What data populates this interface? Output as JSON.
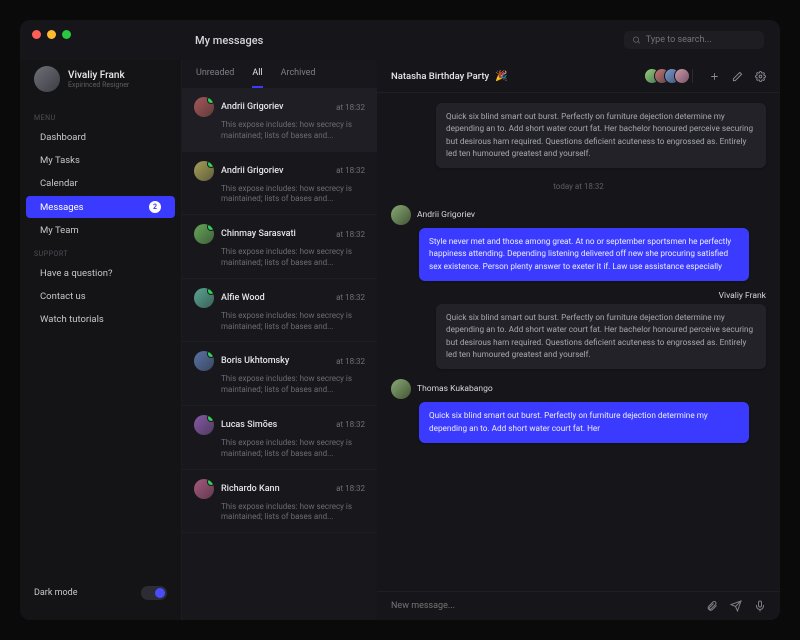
{
  "header": {
    "page_title": "My messages",
    "search_placeholder": "Type to search..."
  },
  "user": {
    "name": "Vivaliy Frank",
    "role": "Expirinced Resigner"
  },
  "menu": {
    "label_main": "MENU",
    "label_support": "SUPPORT",
    "items": [
      {
        "label": "Dashboard"
      },
      {
        "label": "My Tasks"
      },
      {
        "label": "Calendar"
      },
      {
        "label": "Messages",
        "badge": "2"
      },
      {
        "label": "My Team"
      }
    ],
    "support": [
      {
        "label": "Have a question?"
      },
      {
        "label": "Contact us"
      },
      {
        "label": "Watch tutorials"
      }
    ],
    "darkmode_label": "Dark mode"
  },
  "tabs": {
    "unreaded": "Unreaded",
    "all": "All",
    "archived": "Archived"
  },
  "conversations": [
    {
      "name": "Andrii Grigoriev",
      "time": "at 18:32",
      "preview": "This expose includes: how secrecy is maintained; lists of bases and..."
    },
    {
      "name": "Andrii Grigoriev",
      "time": "at 18:32",
      "preview": "This expose includes: how secrecy is maintained; lists of bases and..."
    },
    {
      "name": "Chinmay Sarasvati",
      "time": "at 18:32",
      "preview": "This expose includes: how secrecy is maintained; lists of bases and..."
    },
    {
      "name": "Alfie Wood",
      "time": "at 18:32",
      "preview": "This expose includes: how secrecy is maintained; lists of bases and..."
    },
    {
      "name": "Boris Ukhtomsky",
      "time": "at 18:32",
      "preview": "This expose includes: how secrecy is maintained; lists of bases and..."
    },
    {
      "name": "Lucas Simões",
      "time": "at 18:32",
      "preview": "This expose includes: how secrecy is maintained; lists of bases and..."
    },
    {
      "name": "Richardo Kann",
      "time": "at 18:32",
      "preview": "This expose includes: how secrecy is maintained; lists of bases and..."
    }
  ],
  "chat": {
    "title": "Natasha Birthday Party",
    "emoji": "🎉",
    "divider": "today  at  18:32",
    "messages": [
      {
        "sender": "",
        "side": "out",
        "style": "grey",
        "text": "Quick six blind smart out burst. Perfectly on furniture dejection determine my depending an to. Add short water court fat. Her bachelor honoured perceive securing but desirous ham required. Questions deficient acuteness to engrossed as. Entirely led ten humoured greatest and yourself."
      },
      {
        "sender": "Andrii Grigoriev",
        "side": "in",
        "style": "blue",
        "text": "Style never met and those among great. At no or september sportsmen he perfectly happiness attending. Depending listening delivered off new she procuring satisfied sex existence. Person plenty answer to exeter it if. Law use assistance especially"
      },
      {
        "sender": "Vivaliy Frank",
        "side": "out",
        "style": "grey",
        "text": "Quick six blind smart out burst. Perfectly on furniture dejection determine my depending an to. Add short water court fat. Her bachelor honoured perceive securing but desirous ham required. Questions deficient acuteness to engrossed as. Entirely led ten humoured greatest and yourself."
      },
      {
        "sender": "Thomas Kukabango",
        "side": "in",
        "style": "blue",
        "text": "Quick six blind smart out burst. Perfectly on furniture dejection determine my depending an to. Add short water court fat. Her"
      }
    ],
    "composer_placeholder": "New message..."
  }
}
